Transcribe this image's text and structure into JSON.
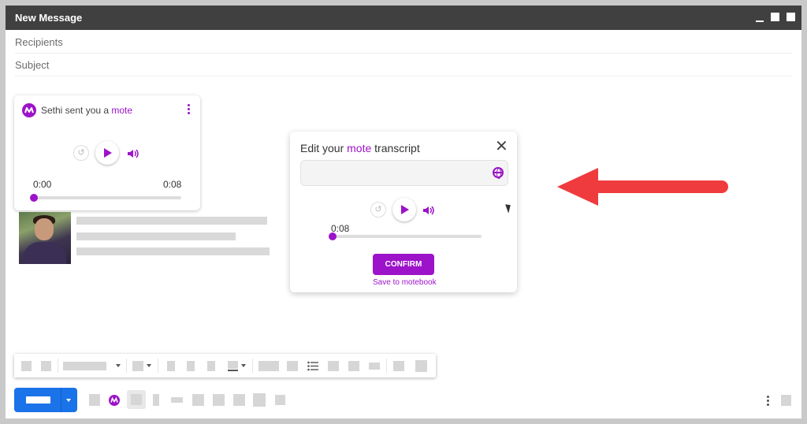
{
  "window": {
    "title": "New Message"
  },
  "fields": {
    "recipients": "Recipients",
    "subject": "Subject"
  },
  "mote_card": {
    "sender_text": "Sethi sent you a ",
    "brand_word": "mote",
    "time_start": "0:00",
    "time_end": "0:08",
    "progress": 0
  },
  "popup": {
    "title_prefix": "Edit your ",
    "title_brand": "mote",
    "title_suffix": " transcript",
    "transcript_value": "",
    "time": "0:08",
    "progress": 0,
    "confirm_label": "CONFIRM",
    "save_link": "Save to motebook"
  },
  "icons": {
    "close": "close-icon",
    "globe": "globe-icon",
    "replay": "replay-icon",
    "play": "play-icon",
    "volume": "volume-icon",
    "more": "kebab-icon"
  },
  "colors": {
    "accent": "#9c13c9",
    "titlebar": "#404040",
    "send_button": "#1a73e8",
    "arrow": "#ef3b3d"
  }
}
